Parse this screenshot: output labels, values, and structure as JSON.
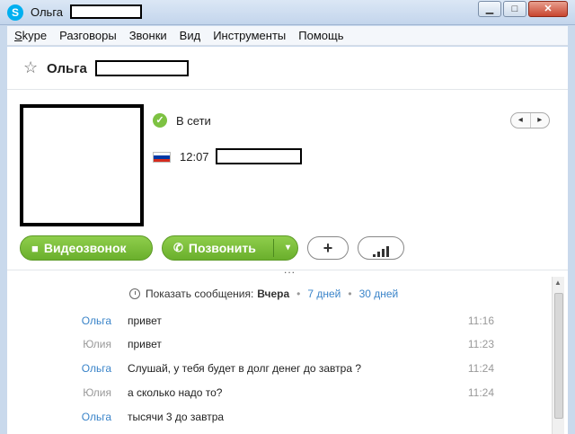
{
  "window": {
    "title": "Ольга",
    "app_icon": "S",
    "controls": {
      "minimize": "▁",
      "maximize": "□",
      "close": "✕"
    }
  },
  "menu": {
    "skype_first": "S",
    "skype_rest": "kype",
    "items": [
      "Разговоры",
      "Звонки",
      "Вид",
      "Инструменты",
      "Помощь"
    ]
  },
  "contact": {
    "name": "Ольга",
    "status": "В сети",
    "local_time": "12:07",
    "flag_colors": [
      "#ffffff",
      "#0039a6",
      "#d52b1e"
    ]
  },
  "buttons": {
    "video_call": "Видеозвонок",
    "call": "Позвонить",
    "add": "+",
    "dropdown": "▾",
    "pager_prev": "◂",
    "pager_next": "▸",
    "more": "..."
  },
  "history": {
    "label": "Показать сообщения:",
    "selected": "Вчера",
    "option_7": "7 дней",
    "option_30": "30 дней",
    "separator": "•"
  },
  "messages": [
    {
      "sender": "Ольга",
      "text": "привет",
      "time": "11:16",
      "self": true
    },
    {
      "sender": "Юлия",
      "text": "привет",
      "time": "11:23",
      "self": false
    },
    {
      "sender": "Ольга",
      "text": "Слушай, у тебя будет в долг денег до завтра ?",
      "time": "11:24",
      "self": true
    },
    {
      "sender": "Юлия",
      "text": "а сколько надо то?",
      "time": "11:24",
      "self": false
    },
    {
      "sender": "Ольга",
      "text": "тысячи 3 до завтра",
      "time": "",
      "self": true
    }
  ],
  "colors": {
    "accent_green": "#7dc242",
    "link_blue": "#3a84c9",
    "muted": "#999999"
  }
}
